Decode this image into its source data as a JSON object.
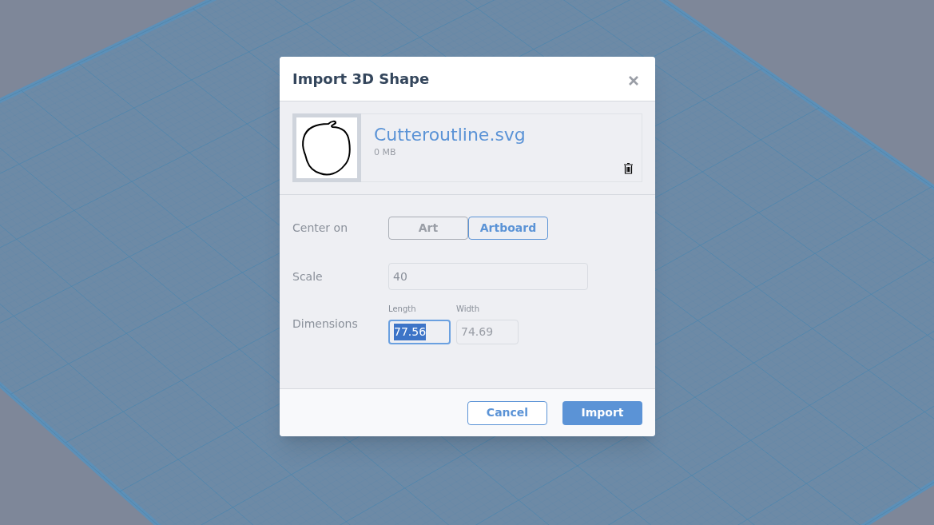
{
  "dialog": {
    "title": "Import 3D Shape",
    "file": {
      "name": "Cutteroutline.svg",
      "size": "0 MB"
    },
    "center_on": {
      "label": "Center on",
      "options": [
        {
          "label": "Art",
          "selected": false
        },
        {
          "label": "Artboard",
          "selected": true
        }
      ]
    },
    "scale": {
      "label": "Scale",
      "value": "40"
    },
    "dimensions": {
      "label": "Dimensions",
      "fields": [
        {
          "label": "Length",
          "value": "77.56",
          "focused": true
        },
        {
          "label": "Width",
          "value": "74.69",
          "focused": false
        }
      ]
    },
    "buttons": [
      {
        "label": "Cancel",
        "kind": "secondary"
      },
      {
        "label": "Import",
        "kind": "primary"
      }
    ]
  }
}
